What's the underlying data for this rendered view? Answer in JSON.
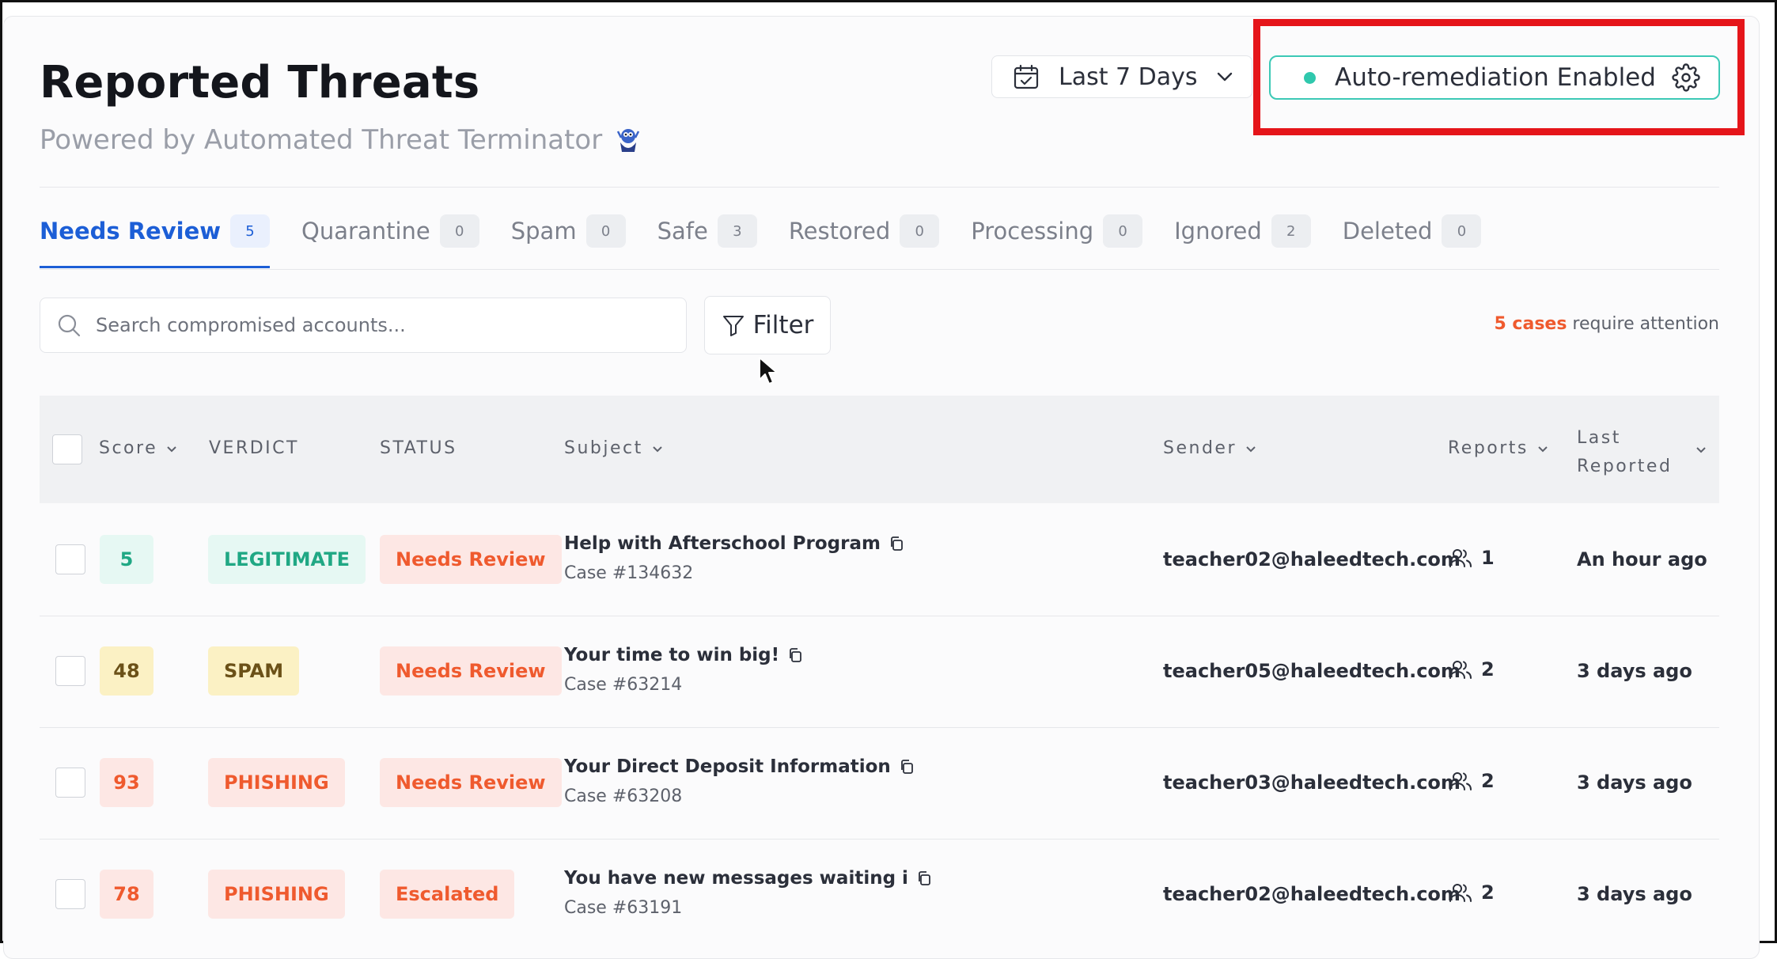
{
  "header": {
    "title": "Reported Threats",
    "subtitle": "Powered by Automated Threat Terminator"
  },
  "date_range": {
    "label": "Last 7 Days"
  },
  "auto_remediation": {
    "label": "Auto-remediation Enabled",
    "status_color": "#2fc8ad"
  },
  "tabs": [
    {
      "label": "Needs Review",
      "count": "5"
    },
    {
      "label": "Quarantine",
      "count": "0"
    },
    {
      "label": "Spam",
      "count": "0"
    },
    {
      "label": "Safe",
      "count": "3"
    },
    {
      "label": "Restored",
      "count": "0"
    },
    {
      "label": "Processing",
      "count": "0"
    },
    {
      "label": "Ignored",
      "count": "2"
    },
    {
      "label": "Deleted",
      "count": "0"
    }
  ],
  "search": {
    "placeholder": "Search compromised accounts..."
  },
  "filter": {
    "label": "Filter"
  },
  "attention": {
    "count": "5 cases",
    "text": " require attention"
  },
  "table": {
    "headers": {
      "score": "Score",
      "verdict": "VERDICT",
      "status": "STATUS",
      "subject": "Subject",
      "sender": "Sender",
      "reports": "Reports",
      "last_reported_1": "Last",
      "last_reported_2": "Reported"
    },
    "rows": [
      {
        "score": "5",
        "verdict": "LEGITIMATE",
        "status": "Needs Review",
        "subject": "Help with Afterschool Program",
        "case": "Case #134632",
        "sender": "teacher02@haleedtech.com",
        "reports": "1",
        "last": "An hour ago"
      },
      {
        "score": "48",
        "verdict": "SPAM",
        "status": "Needs Review",
        "subject": "Your time to win big!",
        "case": "Case #63214",
        "sender": "teacher05@haleedtech.com",
        "reports": "2",
        "last": "3 days ago"
      },
      {
        "score": "93",
        "verdict": "PHISHING",
        "status": "Needs Review",
        "subject": "Your Direct Deposit Information",
        "case": "Case #63208",
        "sender": "teacher03@haleedtech.com",
        "reports": "2",
        "last": "3 days ago"
      },
      {
        "score": "78",
        "verdict": "PHISHING",
        "status": "Escalated",
        "subject": "You have new messages waiting i",
        "case": "Case #63191",
        "sender": "teacher02@haleedtech.com",
        "reports": "2",
        "last": "3 days ago"
      }
    ]
  },
  "colors": {
    "accent_blue": "#1c5ed6",
    "highlight_red": "#e5151a",
    "attention_orange": "#ef5a2e"
  }
}
